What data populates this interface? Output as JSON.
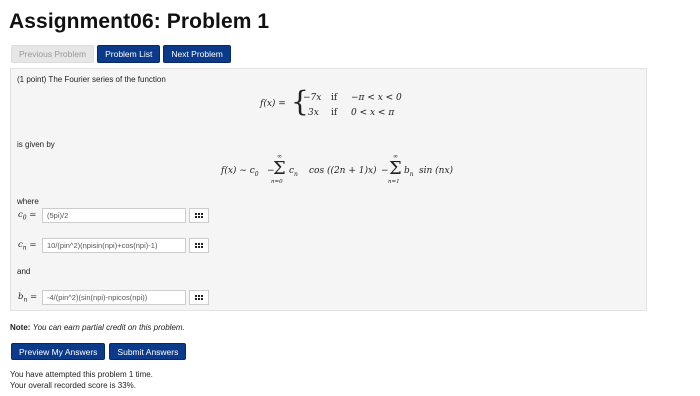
{
  "page_title": "Assignment06: Problem 1",
  "nav": {
    "previous": "Previous Problem",
    "list": "Problem List",
    "next": "Next Problem"
  },
  "problem": {
    "intro": "(1 point) The Fourier series of the function",
    "func_lhs": "f(x) =",
    "case1_expr": "−7x",
    "case1_if": "if",
    "case1_cond": "−π < x < 0",
    "case2_expr": "3x",
    "case2_if": "if",
    "case2_cond": "0 < x < π",
    "given_by": "is given by",
    "series_lhs": "f(x) ∼ c",
    "series_c0_sub": "0",
    "series_minus1": "−",
    "sum_top": "∞",
    "sum1_bottom": "n=0",
    "term1": "c",
    "term1_sub": "n",
    "cos_part": "cos ((2n + 1)x)",
    "series_minus2": "−",
    "sum2_bottom": "n=1",
    "term2": "b",
    "term2_sub": "n",
    "sin_part": "sin (nx)",
    "where": "where",
    "and": "and",
    "fields": [
      {
        "label": "c",
        "sub": "0",
        "eq": "=",
        "value": "(5pi)/2"
      },
      {
        "label": "c",
        "sub": "n",
        "eq": "=",
        "value": "10/(pin^2)(npisin(npi)+cos(npi)-1)"
      },
      {
        "label": "b",
        "sub": "n",
        "eq": "=",
        "value": "-4/(pin^2)(sin(npi)-npicos(npi))"
      }
    ]
  },
  "note_label": "Note:",
  "note_text": "You can earn partial credit on this problem.",
  "actions": {
    "preview": "Preview My Answers",
    "submit": "Submit Answers"
  },
  "status": {
    "attempts": "You have attempted this problem 1 time.",
    "score": "Your overall recorded score is 33%."
  }
}
